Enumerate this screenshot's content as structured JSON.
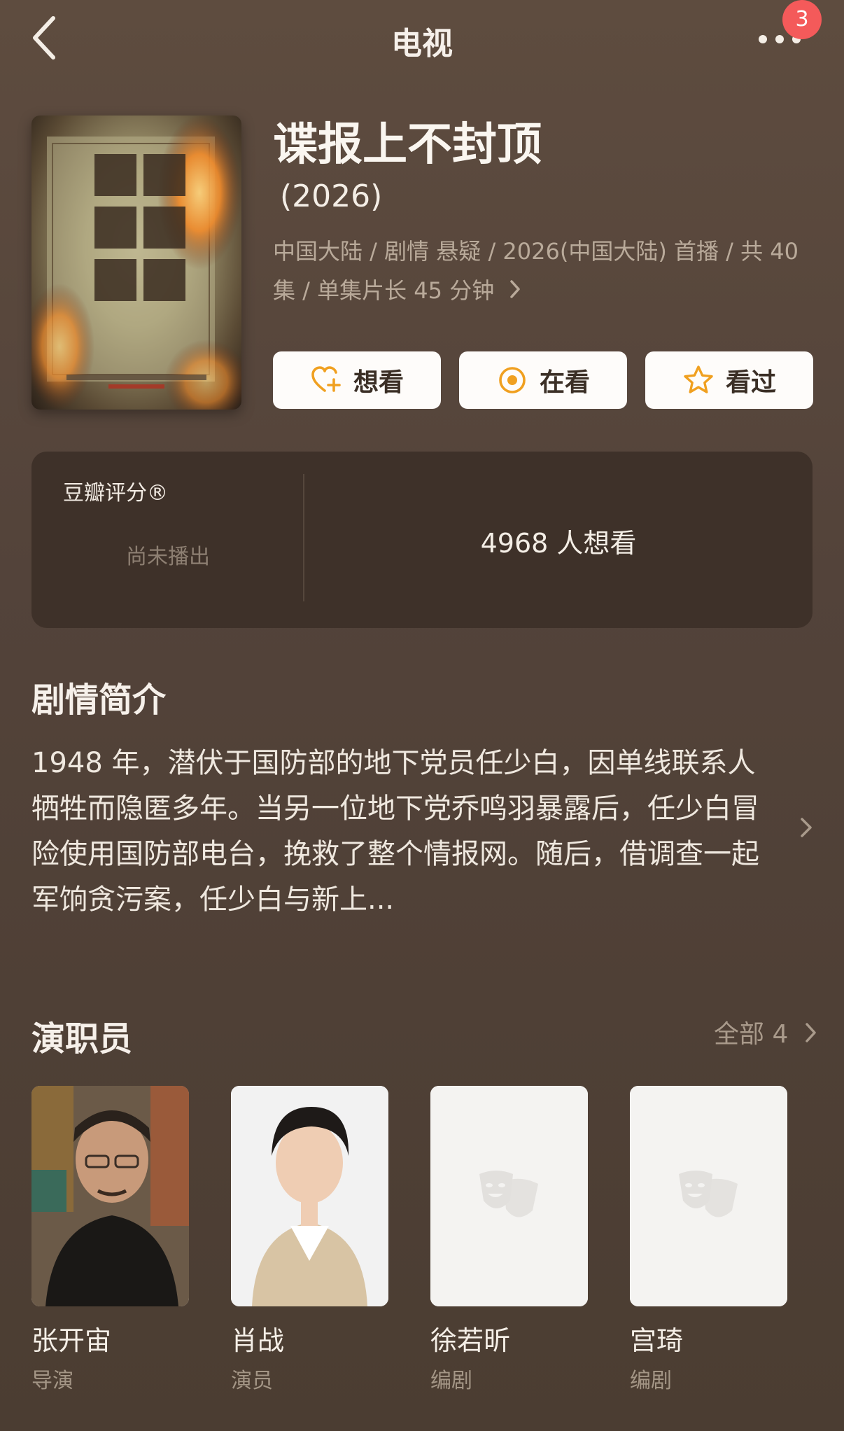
{
  "topbar": {
    "title": "电视",
    "back_icon": "back-arrow-icon",
    "more_icon": "more-dots-icon",
    "badge_count": "3"
  },
  "show": {
    "title": "谍报上不封顶",
    "year": "(2026)",
    "meta_line1": "中国大陆 / 剧情 悬疑 / 2026(中国大陆) 首播 / 共 40",
    "meta_line2": "集 / 单集片长 45 分钟"
  },
  "actions": [
    {
      "label": "想看",
      "icon": "heart-plus-icon"
    },
    {
      "label": "在看",
      "icon": "target-icon"
    },
    {
      "label": "看过",
      "icon": "star-icon"
    }
  ],
  "rating": {
    "label": "豆瓣评分®",
    "status": "尚未播出",
    "want_count": "4968 人想看"
  },
  "synopsis": {
    "title": "剧情简介",
    "text": "1948 年，潜伏于国防部的地下党员任少白，因单线联系人牺牲而隐匿多年。当另一位地下党乔鸣羽暴露后，任少白冒险使用国防部电台，挽救了整个情报网。随后，借调查一起军饷贪污案，任少白与新上..."
  },
  "cast": {
    "title": "演职员",
    "all_label": "全部 4",
    "members": [
      {
        "name": "张开宙",
        "role": "导演"
      },
      {
        "name": "肖战",
        "role": "演员"
      },
      {
        "name": "徐若昕",
        "role": "编剧"
      },
      {
        "name": "宫琦",
        "role": "编剧"
      }
    ]
  },
  "colors": {
    "background": "#5a493c",
    "card": "#3e3129",
    "accent": "#f0a020",
    "badge": "#f45a5a"
  }
}
